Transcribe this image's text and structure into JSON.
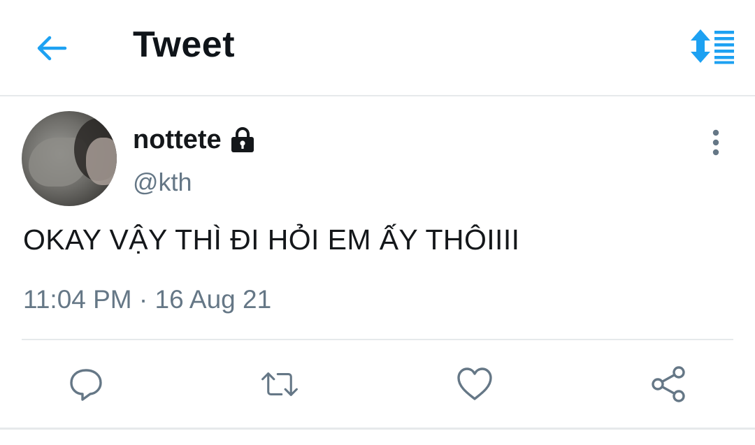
{
  "header": {
    "title": "Tweet",
    "back_icon": "arrow-left-icon",
    "sort_icon": "sort-icon",
    "accent_color": "#1da1f2"
  },
  "tweet": {
    "display_name": "nottete",
    "protected_icon": "lock-icon",
    "handle": "@kth",
    "text": "OKAY VẬY THÌ ĐI HỎI EM ẤY THÔIIII",
    "timestamp": "11:04 PM · 16 Aug 21",
    "more_icon": "more-vertical-icon"
  },
  "actions": [
    {
      "name": "reply",
      "icon": "comment-icon"
    },
    {
      "name": "retweet",
      "icon": "retweet-icon"
    },
    {
      "name": "like",
      "icon": "heart-icon"
    },
    {
      "name": "share",
      "icon": "share-icon"
    }
  ],
  "colors": {
    "text_primary": "#14171a",
    "text_secondary": "#657786",
    "divider": "#e6e9eb",
    "icon_gray": "#657786"
  }
}
